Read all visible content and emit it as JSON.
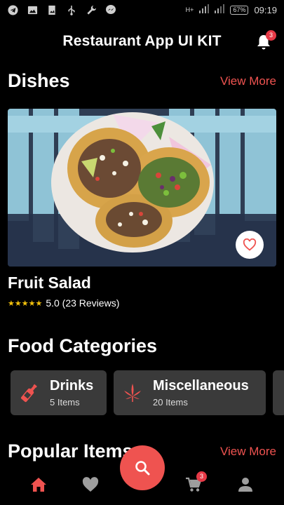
{
  "status_bar": {
    "battery": "67%",
    "time": "09:19",
    "network": "H+"
  },
  "app_bar": {
    "title": "Restaurant App UI KIT",
    "notification_count": "3"
  },
  "dishes_section": {
    "title": "Dishes",
    "view_more": "View More"
  },
  "featured_dish": {
    "name": "Fruit Salad",
    "stars": "★★★★★",
    "rating_text": "5.0 (23 Reviews)"
  },
  "categories_section": {
    "title": "Food Categories",
    "items": [
      {
        "name": "Drinks",
        "count": "5 Items",
        "icon": "bottle-icon"
      },
      {
        "name": "Miscellaneous",
        "count": "20 Items",
        "icon": "leaf-icon"
      }
    ]
  },
  "popular_section": {
    "title": "Popular Items",
    "view_more": "View More"
  },
  "bottom_nav": {
    "items": [
      "home-icon",
      "heart-icon",
      "search-icon",
      "cart-icon",
      "profile-icon"
    ],
    "cart_count": "3"
  },
  "colors": {
    "accent": "#ef5350",
    "card_bg": "#3a3a3a",
    "background": "#000000"
  }
}
